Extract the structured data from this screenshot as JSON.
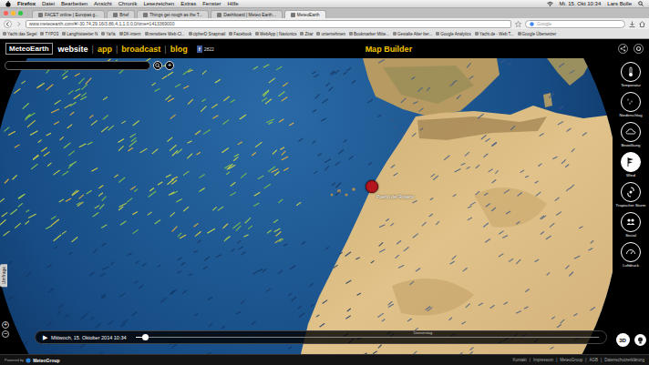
{
  "menubar": {
    "items": [
      "Firefox",
      "Datei",
      "Bearbeiten",
      "Ansicht",
      "Chronik",
      "Lesezeichen",
      "Extras",
      "Fenster",
      "Hilfe"
    ],
    "clock": "Mi. 15. Okt 10:34",
    "user": "Lars Bolle"
  },
  "tabs": [
    {
      "label": "FACET online | Europas g...",
      "selected": false
    },
    {
      "label": "Brief",
      "selected": false
    },
    {
      "label": "Things get rough as the T...",
      "selected": false
    },
    {
      "label": "Dashboard | Meteo Earth...",
      "selected": false
    },
    {
      "label": "MeteoEarth",
      "selected": true
    }
  ],
  "toolbar": {
    "url": "www.meteoearth.com/#/-30.74,29.16/3.86,4,1,1,0,0,0/time=1413369000",
    "search": {
      "placeholder": "Google"
    }
  },
  "bookmarks": [
    "Yacht das Segel",
    "TYPO3",
    "Langfristwetter N",
    "YaYa",
    "DK-intern",
    "zensitiere Web-Cl...",
    "cipherD Snapmail",
    "Facebook",
    "WebApp | Navionics",
    "Zitar",
    "unternehmen",
    "Bookmarker Mitte...",
    "Gestalte Alter ber...",
    "Google Analytics",
    "Yacht.de - Web T...",
    "Google Übersetzer"
  ],
  "site": {
    "logo": "MeteoEarth",
    "nav": [
      {
        "label": "website",
        "selected": true
      },
      {
        "label": "app",
        "selected": false
      },
      {
        "label": "broadcast",
        "selected": false
      },
      {
        "label": "blog",
        "selected": false
      }
    ],
    "separator": "|",
    "facebook": "f",
    "like_count": "2822",
    "title": "Map Builder"
  },
  "layers": [
    {
      "label": "Temperatur",
      "selected": false
    },
    {
      "label": "Niederschlag",
      "selected": false
    },
    {
      "label": "Bewölkung",
      "selected": false
    },
    {
      "label": "Wind",
      "selected": true
    },
    {
      "label": "Tropischer Sturm",
      "selected": false
    },
    {
      "label": "Social",
      "selected": false
    },
    {
      "label": "Luftdruck",
      "selected": false
    }
  ],
  "map": {
    "search": {
      "placeholder": ""
    },
    "add_button": "+",
    "pin": {
      "label": "Puerto del Rosario"
    },
    "side_tab": "Umfrage",
    "zoom": [
      "+",
      "−"
    ]
  },
  "timeline": {
    "play": "▶",
    "date": "Mittwoch, 15. Oktober 2014 10:34",
    "next_day": "Donnerstag",
    "level": 0.02
  },
  "mode_button": "3D",
  "footer": {
    "powered": "Powered by",
    "brand": "MeteoGroup",
    "links": [
      "Kontakt",
      "Impressum",
      "MeteoGroup",
      "AGB",
      "Datenschutzerklärung"
    ],
    "separator": "|"
  }
}
